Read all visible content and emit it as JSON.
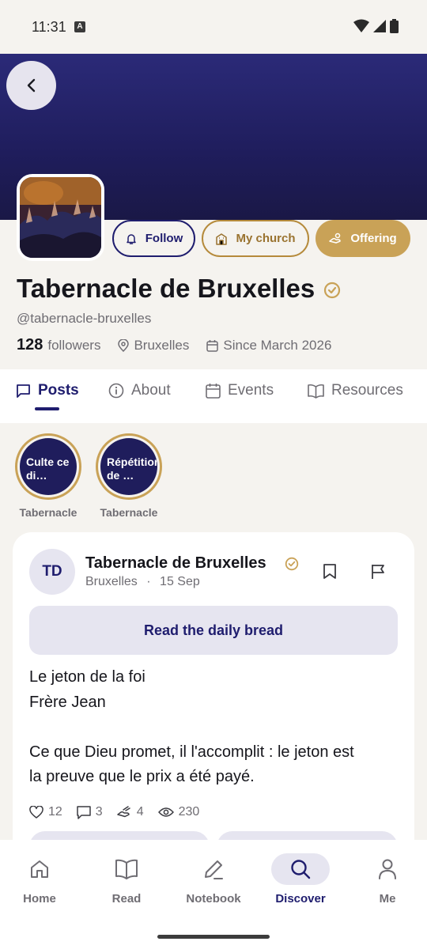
{
  "status_bar": {
    "time": "11:31",
    "notif_letter": "A"
  },
  "church": {
    "name": "Tabernacle de Bruxelles",
    "handle": "@tabernacle-bruxelles",
    "followers_count": "128",
    "followers_label": "followers",
    "location": "Bruxelles",
    "since": "Since March 2026"
  },
  "buttons": {
    "follow": "Follow",
    "my_church": "My church",
    "offering": "Offering"
  },
  "tabs": [
    {
      "label": "Posts",
      "icon": "chat-bubble-icon",
      "active": true
    },
    {
      "label": "About",
      "icon": "info-icon",
      "active": false
    },
    {
      "label": "Events",
      "icon": "calendar-icon",
      "active": false
    },
    {
      "label": "Resources",
      "icon": "book-open-icon",
      "active": false
    }
  ],
  "stories": [
    {
      "title": "Culte ce di…",
      "label": "Tabernacle"
    },
    {
      "title": "Répétition de …",
      "label": "Tabernacle"
    }
  ],
  "post": {
    "initials": "TD",
    "author": "Tabernacle de Bruxelles",
    "location": "Bruxelles",
    "separator": "·",
    "date": "15 Sep",
    "cta": "Read the daily bread",
    "lines": [
      "Le jeton de la foi",
      "Frère Jean",
      "",
      "Ce que Dieu promet, il l'accomplit : le jeton est",
      "la preuve que le prix a été payé."
    ],
    "likes": "12",
    "comments": "3",
    "offerings": "4",
    "views": "230"
  },
  "nav": [
    {
      "label": "Home",
      "icon": "home-icon",
      "active": false
    },
    {
      "label": "Read",
      "icon": "book-icon",
      "active": false
    },
    {
      "label": "Notebook",
      "icon": "pencil-icon",
      "active": false
    },
    {
      "label": "Discover",
      "icon": "search-icon",
      "active": true
    },
    {
      "label": "Me",
      "icon": "person-icon",
      "active": false
    }
  ],
  "colors": {
    "primary": "#1f1d6e",
    "gold": "#c9a257",
    "background": "#f5f3ef",
    "cover": "#1f1d5c"
  }
}
